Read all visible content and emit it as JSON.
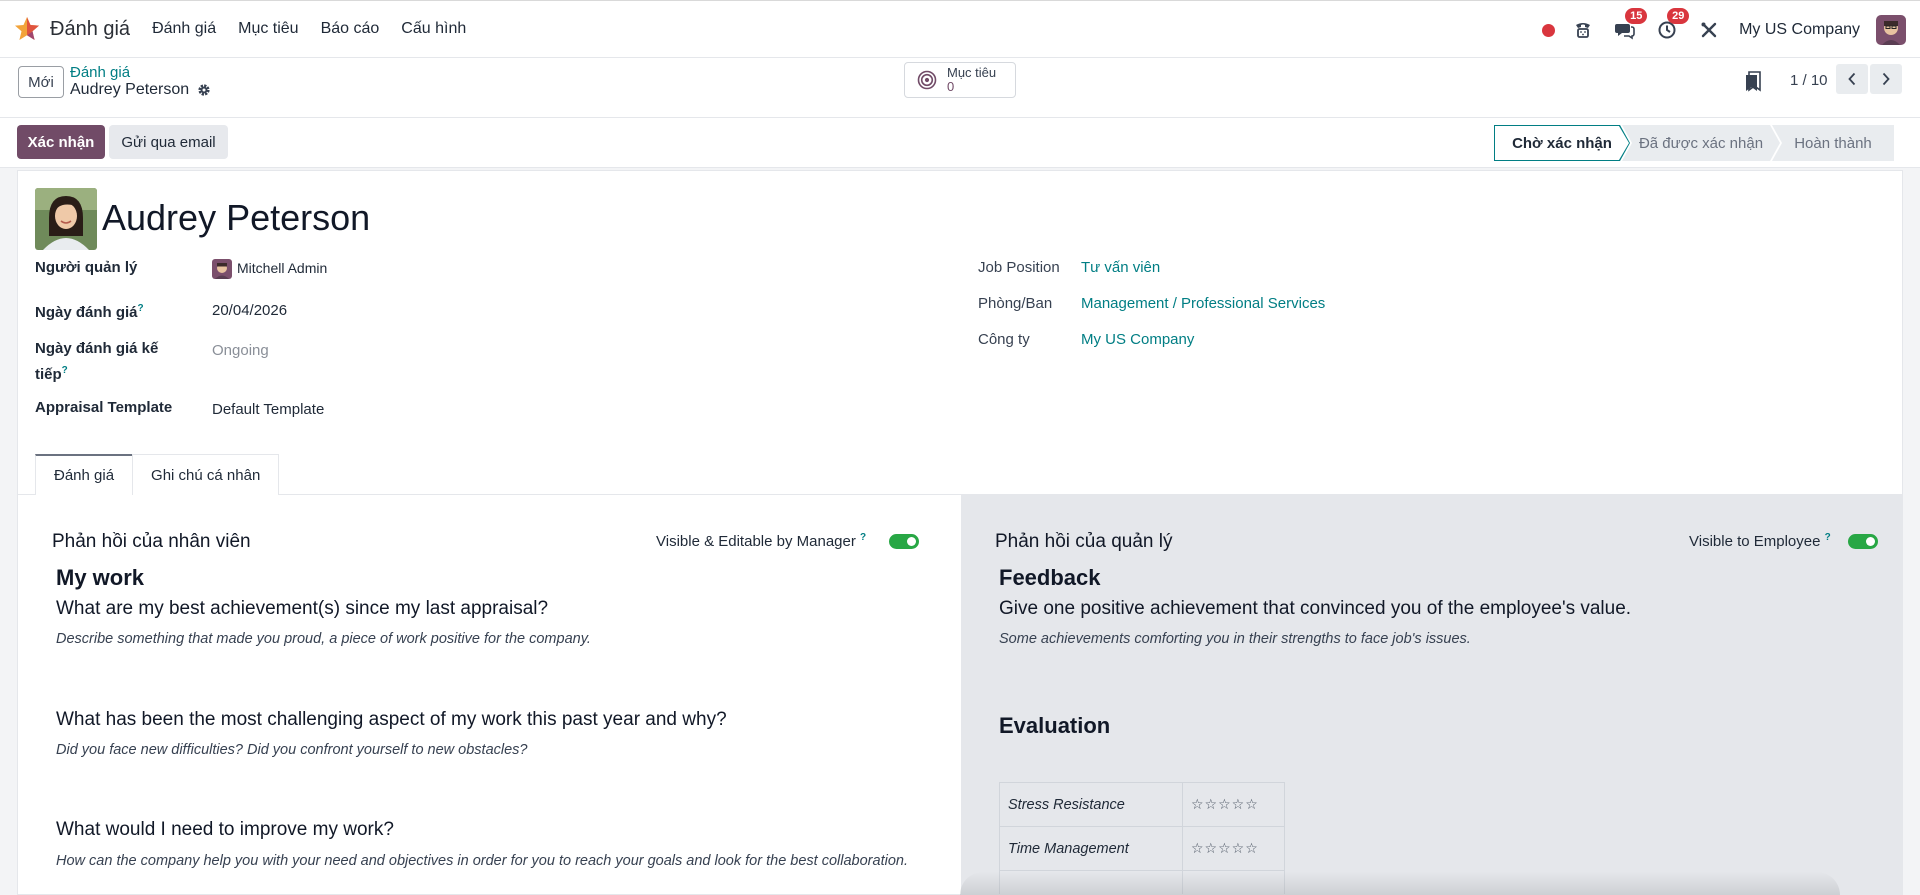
{
  "navbar": {
    "app_name": "Đánh giá",
    "menu": [
      "Đánh giá",
      "Mục tiêu",
      "Báo cáo",
      "Cấu hình"
    ],
    "messages_count": "15",
    "activities_count": "29",
    "company": "My US Company"
  },
  "control": {
    "new_label": "Mới",
    "breadcrumb": "Đánh giá",
    "record_name": "Audrey Peterson",
    "goal_label": "Mục tiêu",
    "goal_count": "0",
    "pager": "1 / 10"
  },
  "statusbar": {
    "confirm_label": "Xác nhận",
    "email_label": "Gửi qua email",
    "stages": [
      "Chờ xác nhận",
      "Đã được xác nhận",
      "Hoàn thành"
    ],
    "active_stage": "Chờ xác nhận"
  },
  "employee": {
    "name": "Audrey Peterson",
    "fields_left": {
      "manager_label": "Người quản lý",
      "manager_value": "Mitchell Admin",
      "date_label": "Ngày đánh giá",
      "date_value": "20/04/2026",
      "next_date_label_1": "Ngày đánh giá kế",
      "next_date_label_2": "tiếp",
      "next_date_value": "Ongoing",
      "template_label": "Appraisal Template",
      "template_value": "Default Template",
      "help_mark": "?"
    },
    "fields_right": {
      "job_label": "Job Position",
      "job_value": "Tư vấn viên",
      "dept_label": "Phòng/Ban",
      "dept_value": "Management / Professional Services",
      "company_label": "Công ty",
      "company_value": "My US Company"
    }
  },
  "tabs": [
    "Đánh giá",
    "Ghi chú cá nhân"
  ],
  "employee_feedback": {
    "title": "Phản hồi của nhân viên",
    "toggle_label": "Visible & Editable by Manager",
    "toggle_on": true,
    "heading": "My work",
    "q1": "What are my best achievement(s) since my last appraisal?",
    "q1_hint": "Describe something that made you proud, a piece of work positive for the company.",
    "q2": "What has been the most challenging aspect of my work this past year and why?",
    "q2_hint": "Did you face new difficulties? Did you confront yourself to new obstacles?",
    "q3": "What would I need to improve my work?",
    "q3_hint": "How can the company help you with your need and objectives in order for you to reach your goals and look for the best collaboration."
  },
  "manager_feedback": {
    "title": "Phản hồi của quản lý",
    "toggle_label": "Visible to Employee",
    "toggle_on": true,
    "heading": "Feedback",
    "q1": "Give one positive achievement that convinced you of the employee's value.",
    "q1_hint": "Some achievements comforting you in their strengths to face job's issues.",
    "eval_heading": "Evaluation",
    "criteria": [
      {
        "name": "Stress Resistance",
        "stars": "☆☆☆☆☆"
      },
      {
        "name": "Time Management",
        "stars": "☆☆☆☆☆"
      }
    ]
  },
  "colors": {
    "brand": "#714b67",
    "link": "#017e84",
    "badge": "#d9363e",
    "toggle": "#28a745"
  }
}
